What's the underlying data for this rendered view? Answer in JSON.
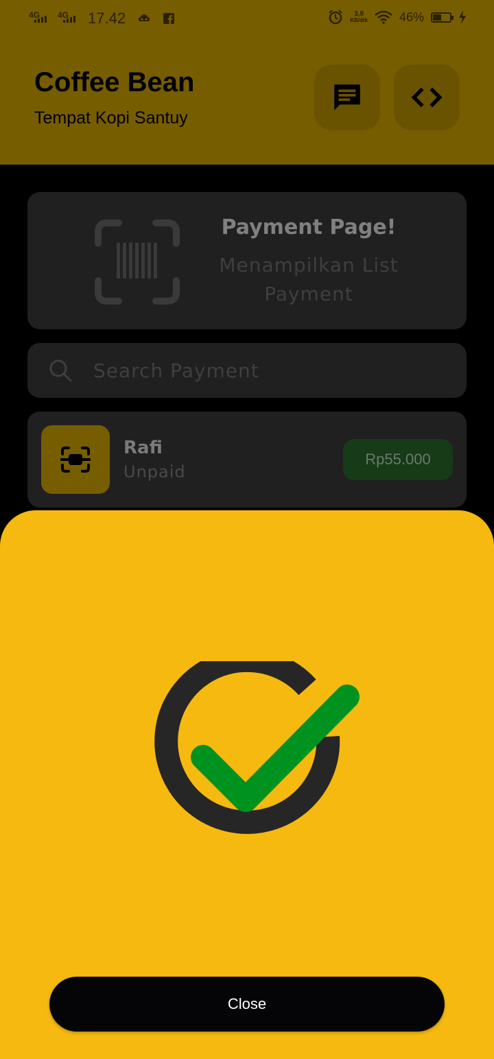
{
  "status_bar": {
    "network_1": "4G",
    "network_2": "4G",
    "time": "17.42",
    "speed_value": "3,8",
    "speed_unit": "KB/dtk",
    "battery_percent": "46%",
    "battery_level": 0.46
  },
  "header": {
    "title": "Coffee Bean",
    "subtitle": "Tempat Kopi Santuy",
    "chat_icon": "chat-icon",
    "code_icon": "code-icon"
  },
  "hero": {
    "title": "Payment Page!",
    "description": "Menampilkan List Payment",
    "icon": "barcode-scan-icon"
  },
  "search": {
    "placeholder": "Search Payment",
    "value": ""
  },
  "payments": [
    {
      "name": "Rafi",
      "status": "Unpaid",
      "amount": "Rp55.000"
    }
  ],
  "sheet": {
    "icon": "success-check-icon",
    "close_label": "Close"
  },
  "colors": {
    "accent": "#f6b90f",
    "accent_dimmed": "#765d00",
    "success": "#00921f",
    "dark": "#262626"
  }
}
